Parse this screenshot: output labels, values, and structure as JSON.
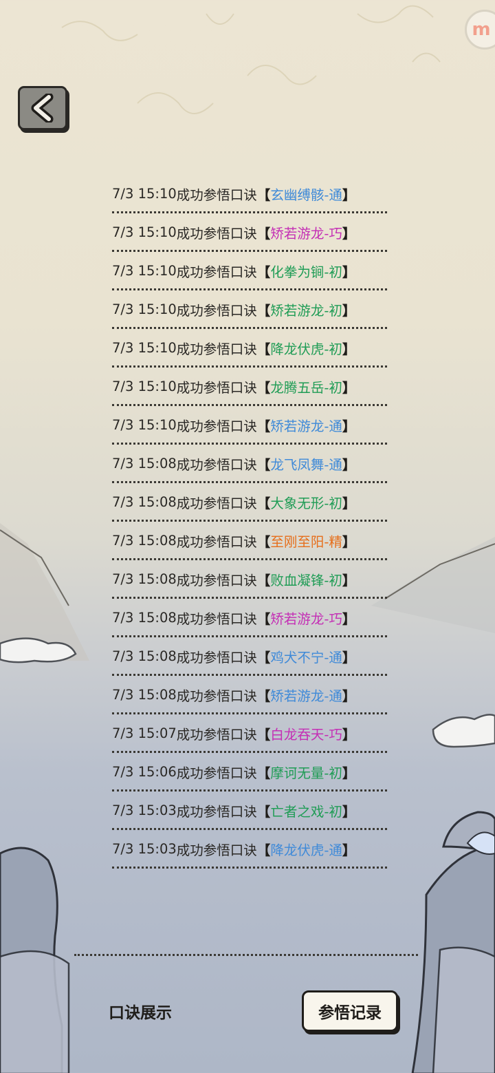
{
  "app": {
    "logo_text": "m"
  },
  "records": [
    {
      "time": "7/3 15:10",
      "text": "成功参悟口诀",
      "skill": "玄幽缚骸-通",
      "color": "#3f8ad8"
    },
    {
      "time": "7/3 15:10",
      "text": "成功参悟口诀",
      "skill": "矫若游龙-巧",
      "color": "#c42fb5"
    },
    {
      "time": "7/3 15:10",
      "text": "成功参悟口诀",
      "skill": "化拳为锏-初",
      "color": "#1f9c55"
    },
    {
      "time": "7/3 15:10",
      "text": "成功参悟口诀",
      "skill": "矫若游龙-初",
      "color": "#1f9c55"
    },
    {
      "time": "7/3 15:10",
      "text": "成功参悟口诀",
      "skill": "降龙伏虎-初",
      "color": "#1f9c55"
    },
    {
      "time": "7/3 15:10",
      "text": "成功参悟口诀",
      "skill": "龙腾五岳-初",
      "color": "#1f9c55"
    },
    {
      "time": "7/3 15:10",
      "text": "成功参悟口诀",
      "skill": "矫若游龙-通",
      "color": "#3f8ad8"
    },
    {
      "time": "7/3 15:08",
      "text": "成功参悟口诀",
      "skill": "龙飞凤舞-通",
      "color": "#3f8ad8"
    },
    {
      "time": "7/3 15:08",
      "text": "成功参悟口诀",
      "skill": "大象无形-初",
      "color": "#1f9c55"
    },
    {
      "time": "7/3 15:08",
      "text": "成功参悟口诀",
      "skill": "至刚至阳-精",
      "color": "#e66f1c"
    },
    {
      "time": "7/3 15:08",
      "text": "成功参悟口诀",
      "skill": "败血凝锋-初",
      "color": "#1f9c55"
    },
    {
      "time": "7/3 15:08",
      "text": "成功参悟口诀",
      "skill": "矫若游龙-巧",
      "color": "#c42fb5"
    },
    {
      "time": "7/3 15:08",
      "text": "成功参悟口诀",
      "skill": "鸡犬不宁-通",
      "color": "#3f8ad8"
    },
    {
      "time": "7/3 15:08",
      "text": "成功参悟口诀",
      "skill": "矫若游龙-通",
      "color": "#3f8ad8"
    },
    {
      "time": "7/3 15:07",
      "text": "成功参悟口诀",
      "skill": "白龙吞天-巧",
      "color": "#c42fb5"
    },
    {
      "time": "7/3 15:06",
      "text": "成功参悟口诀",
      "skill": "摩诃无量-初",
      "color": "#1f9c55"
    },
    {
      "time": "7/3 15:03",
      "text": "成功参悟口诀",
      "skill": "亡者之戏-初",
      "color": "#1f9c55"
    },
    {
      "time": "7/3 15:03",
      "text": "成功参悟口诀",
      "skill": "降龙伏虎-通",
      "color": "#3f8ad8"
    }
  ],
  "brackets": {
    "open": "【",
    "close": "】"
  },
  "tabs": {
    "showcase_label": "口诀展示",
    "record_label": "参悟记录"
  },
  "icons": {
    "back": "chevron-left-icon"
  }
}
